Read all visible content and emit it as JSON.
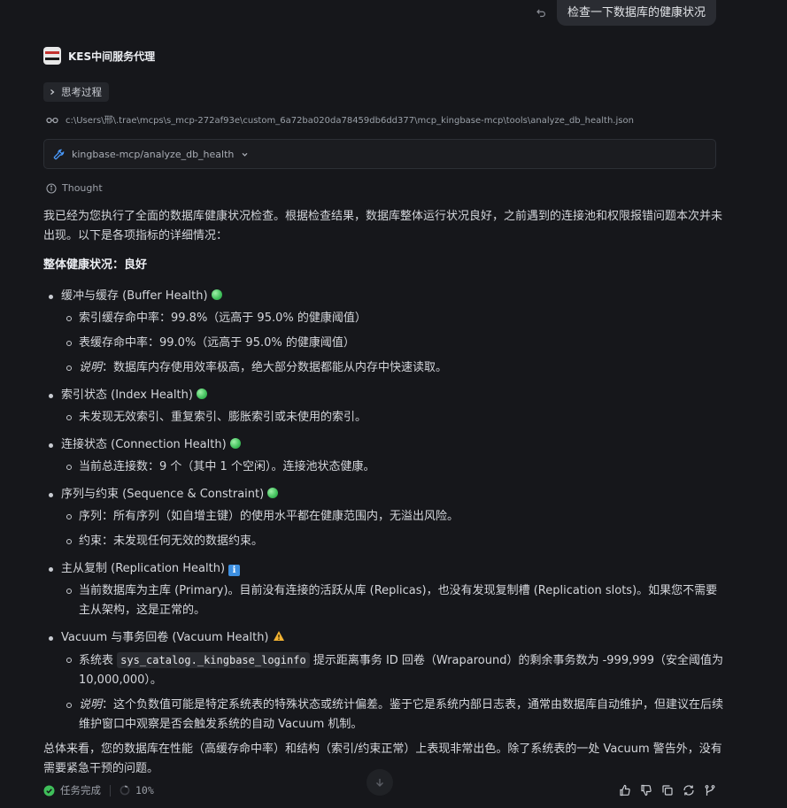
{
  "user": {
    "message": "检查一下数据库的健康状况"
  },
  "agent": {
    "name": "KES中间服务代理"
  },
  "thinking": {
    "label": "思考过程"
  },
  "tool": {
    "path": "c:\\Users\\邢\\.trae\\mcps\\s_mcp-272af93e\\custom_6a72ba020da78459db6dd377\\mcp_kingbase-mcp\\tools\\analyze_db_health.json",
    "name": "kingbase-mcp/analyze_db_health"
  },
  "thought": {
    "label": "Thought"
  },
  "body": {
    "intro": "我已经为您执行了全面的数据库健康状况检查。根据检查结果，数据库整体运行状况良好，之前遇到的连接池和权限报错问题本次并未出现。以下是各项指标的详细情况：",
    "overall": "整体健康状况：良好",
    "buffer": {
      "title": "缓冲与缓存 (Buffer Health)",
      "index_hit": "索引缓存命中率：99.8%（远高于 95.0% 的健康阈值）",
      "table_hit": "表缓存命中率：99.0%（远高于 95.0% 的健康阈值）",
      "note_label": "说明",
      "note": "：数据库内存使用效率极高，绝大部分数据都能从内存中快速读取。"
    },
    "index": {
      "title": "索引状态 (Index Health)",
      "item": "未发现无效索引、重复索引、膨胀索引或未使用的索引。"
    },
    "connection": {
      "title": "连接状态 (Connection Health)",
      "item": "当前总连接数：9 个（其中 1 个空闲）。连接池状态健康。"
    },
    "sequence": {
      "title": "序列与约束 (Sequence & Constraint)",
      "seq": "序列：所有序列（如自增主键）的使用水平都在健康范围内，无溢出风险。",
      "con": "约束：未发现任何无效的数据约束。"
    },
    "replication": {
      "title": "主从复制 (Replication Health)",
      "badge": "i",
      "item": "当前数据库为主库 (Primary)。目前没有连接的活跃从库 (Replicas)，也没有发现复制槽 (Replication slots)。如果您不需要主从架构，这是正常的。"
    },
    "vacuum": {
      "title": "Vacuum 与事务回卷 (Vacuum Health)",
      "item_prefix": "系统表",
      "item_code": "sys_catalog._kingbase_loginfo",
      "item_suffix": "提示距离事务 ID 回卷（Wraparound）的剩余事务数为 -999,999（安全阈值为 10,000,000）。",
      "note_label": "说明",
      "note": "：这个负数值可能是特定系统表的特殊状态或统计偏差。鉴于它是系统内部日志表，通常由数据库自动维护，但建议在后续维护窗口中观察是否会触发系统的自动 Vacuum 机制。"
    },
    "summary": "总体来看，您的数据库在性能（高缓存命中率）和结构（索引/约束正常）上表现非常出色。除了系统表的一处 Vacuum 警告外，没有需要紧急干预的问题。"
  },
  "footer": {
    "status": "任务完成",
    "progress": "10%"
  },
  "colors": {
    "background": "#16171b",
    "ok": "#3fbf5a",
    "info": "#3d8fe0",
    "warn": "#f2b233"
  }
}
